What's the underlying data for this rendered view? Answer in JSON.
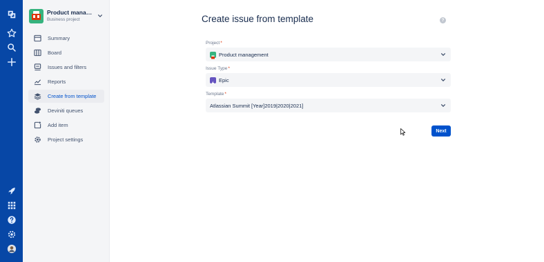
{
  "global_nav": {
    "bg_color": "#0747a6",
    "top_icons": [
      "jira-logo-icon",
      "star-icon",
      "search-icon",
      "plus-icon"
    ],
    "bottom_icons": [
      "rocket-icon",
      "app-switcher-icon",
      "help-icon",
      "settings-icon",
      "user-avatar"
    ]
  },
  "sidebar": {
    "project_name": "Product manage…",
    "project_type": "Business project",
    "items": [
      {
        "label": "Summary",
        "icon": "summary-icon"
      },
      {
        "label": "Board",
        "icon": "board-icon"
      },
      {
        "label": "Issues and filters",
        "icon": "issues-icon"
      },
      {
        "label": "Reports",
        "icon": "reports-icon"
      },
      {
        "label": "Create from template",
        "icon": "template-icon",
        "active": true
      },
      {
        "label": "Deviniti queues",
        "icon": "queues-icon"
      },
      {
        "label": "Add item",
        "icon": "add-item-icon"
      },
      {
        "label": "Project settings",
        "icon": "gear-icon"
      }
    ]
  },
  "main": {
    "title": "Create issue from template",
    "help_glyph": "?",
    "fields": [
      {
        "label": "Project",
        "required": "*",
        "value": "Product management",
        "icon": "project-avatar-icon"
      },
      {
        "label": "Issue Type",
        "required": "*",
        "value": "Epic",
        "icon": "epic-icon"
      },
      {
        "label": "Template",
        "required": "*",
        "value": "Atlassian Summit [Year]2019|2020|2021]"
      }
    ],
    "next_label": "Next"
  },
  "colors": {
    "accent": "#0052cc",
    "epic": "#6554c0",
    "project_avatar": "#36b37e"
  }
}
